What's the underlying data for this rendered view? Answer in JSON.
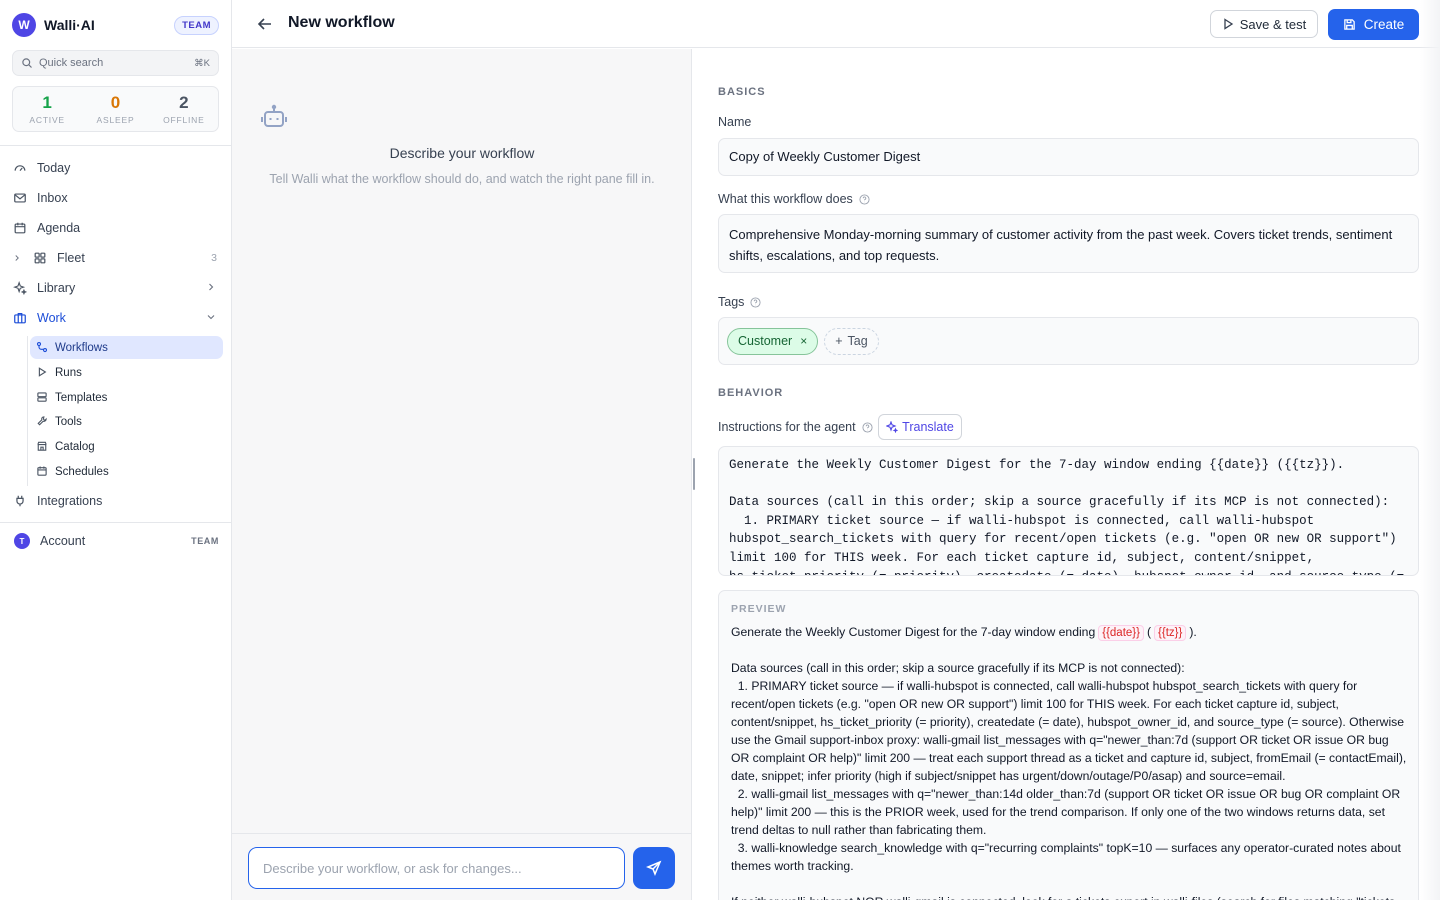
{
  "app": {
    "logo_letter": "W",
    "name": "Walli·AI",
    "badge": "TEAM"
  },
  "search": {
    "placeholder": "Quick search",
    "shortcut": "⌘K"
  },
  "stats": [
    {
      "value": "1",
      "label": "ACTIVE",
      "color": "#16a34a"
    },
    {
      "value": "0",
      "label": "ASLEEP",
      "color": "#d97706"
    },
    {
      "value": "2",
      "label": "OFFLINE",
      "color": "#4b5563"
    }
  ],
  "nav": {
    "today": "Today",
    "inbox": "Inbox",
    "agenda": "Agenda",
    "fleet": "Fleet",
    "fleet_count": "3",
    "library": "Library",
    "work": "Work",
    "integrations": "Integrations"
  },
  "work_sub": [
    {
      "label": "Workflows",
      "icon": "workflow-icon",
      "active": true
    },
    {
      "label": "Runs",
      "icon": "play-icon"
    },
    {
      "label": "Templates",
      "icon": "templates-icon"
    },
    {
      "label": "Tools",
      "icon": "wrench-icon"
    },
    {
      "label": "Catalog",
      "icon": "store-icon"
    },
    {
      "label": "Schedules",
      "icon": "calendar-icon"
    }
  ],
  "account": {
    "initial": "T",
    "label": "Account",
    "tag": "TEAM"
  },
  "header": {
    "title": "New workflow",
    "save_test": "Save & test",
    "create": "Create"
  },
  "chat": {
    "heading": "Describe your workflow",
    "subtext": "Tell Walli what the workflow should do, and watch the right pane fill in.",
    "input_placeholder": "Describe your workflow, or ask for changes..."
  },
  "form": {
    "basics_label": "BASICS",
    "name_label": "Name",
    "name_value": "Copy of Weekly Customer Digest",
    "desc_label": "What this workflow does",
    "desc_value": "Comprehensive Monday-morning summary of customer activity from the past week. Covers ticket trends, sentiment shifts, escalations, and top requests.",
    "tags_label": "Tags",
    "tags": [
      "Customer"
    ],
    "add_tag": "Tag",
    "behavior_label": "BEHAVIOR",
    "instructions_label": "Instructions for the agent",
    "translate": "Translate",
    "instructions_value": "Generate the Weekly Customer Digest for the 7-day window ending {{date}} ({{tz}}).\n\nData sources (call in this order; skip a source gracefully if its MCP is not connected):\n  1. PRIMARY ticket source — if walli-hubspot is connected, call walli-hubspot hubspot_search_tickets with query for recent/open tickets (e.g. \"open OR new OR support\") limit 100 for THIS week. For each ticket capture id, subject, content/snippet, hs_ticket_priority (= priority), createdate (= date), hubspot_owner_id, and source_type (= source)."
  },
  "preview": {
    "label": "PREVIEW",
    "line1_pre": "Generate the Weekly Customer Digest for the 7-day window ending",
    "var_date": "{{date}}",
    "var_tz": "{{tz}}",
    "line1_post": ").",
    "body": "Data sources (call in this order; skip a source gracefully if its MCP is not connected):\n  1. PRIMARY ticket source — if walli-hubspot is connected, call walli-hubspot hubspot_search_tickets with query for recent/open tickets (e.g. \"open OR new OR support\") limit 100 for THIS week. For each ticket capture id, subject, content/snippet, hs_ticket_priority (= priority), createdate (= date), hubspot_owner_id, and source_type (= source). Otherwise use the Gmail support-inbox proxy: walli-gmail list_messages with q=\"newer_than:7d (support OR ticket OR issue OR bug OR complaint OR help)\" limit 200 — treat each support thread as a ticket and capture id, subject, fromEmail (= contactEmail), date, snippet; infer priority (high if subject/snippet has urgent/down/outage/P0/asap) and source=email.\n  2. walli-gmail list_messages with q=\"newer_than:14d older_than:7d (support OR ticket OR issue OR bug OR complaint OR help)\" limit 200 — this is the PRIOR week, used for the trend comparison. If only one of the two windows returns data, set trend deltas to null rather than fabricating them.\n  3. walli-knowledge search_knowledge with q=\"recurring complaints\" topK=10 — surfaces any operator-curated notes about themes worth tracking.\n\nIf neither walli-hubspot NOR walli-gmail is connected, look for a tickets export in walli-files (search for files matching \"tickets"
  }
}
